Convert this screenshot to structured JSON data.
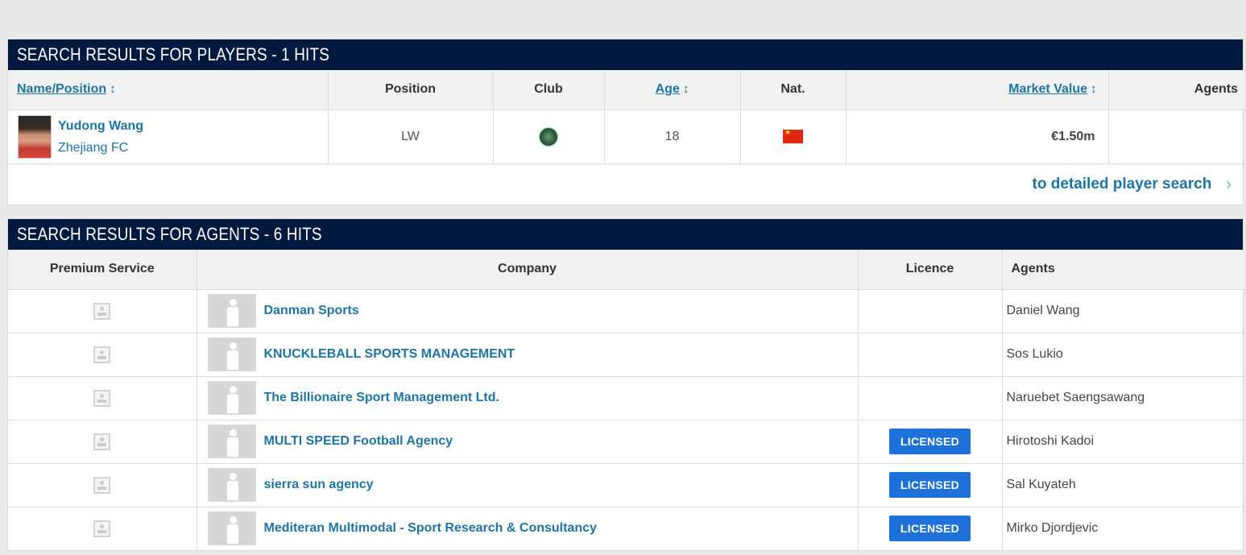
{
  "players_section": {
    "title": "SEARCH RESULTS FOR PLAYERS - 1 HITS",
    "columns": {
      "name_position": "Name/Position",
      "position": "Position",
      "club": "Club",
      "age": "Age",
      "nat": "Nat.",
      "market_value": "Market Value",
      "agents": "Agents"
    },
    "sort_icon": "↕",
    "rows": [
      {
        "name": "Yudong Wang",
        "club_name": "Zhejiang FC",
        "position": "LW",
        "club_logo_icon": "zhejiang-fc-logo",
        "age": "18",
        "nationality_flag": "china-flag",
        "market_value": "€1.50m",
        "agents": ""
      }
    ],
    "detail_link": "to detailed player search",
    "chevron": "›"
  },
  "agents_section": {
    "title": "SEARCH RESULTS FOR AGENTS - 6 HITS",
    "columns": {
      "premium": "Premium Service",
      "company": "Company",
      "licence": "Licence",
      "agents": "Agents"
    },
    "rows": [
      {
        "company": "Danman Sports",
        "licence": "",
        "agent": "Daniel Wang"
      },
      {
        "company": "KNUCKLEBALL SPORTS MANAGEMENT",
        "licence": "",
        "agent": "Sos Lukio"
      },
      {
        "company": "The Billionaire Sport Management Ltd.",
        "licence": "",
        "agent": "Naruebet Saengsawang"
      },
      {
        "company": "MULTI SPEED Football Agency",
        "licence": "LICENSED",
        "agent": "Hirotoshi Kadoi"
      },
      {
        "company": "sierra sun agency",
        "licence": "LICENSED",
        "agent": "Sal Kuyateh"
      },
      {
        "company": "Mediteran Multimodal - Sport Research & Consultancy",
        "licence": "LICENSED",
        "agent": "Mirko Djordjevic"
      }
    ]
  },
  "colors": {
    "header_bg": "#00193f",
    "link": "#1d75a3",
    "badge": "#1e71d8"
  }
}
